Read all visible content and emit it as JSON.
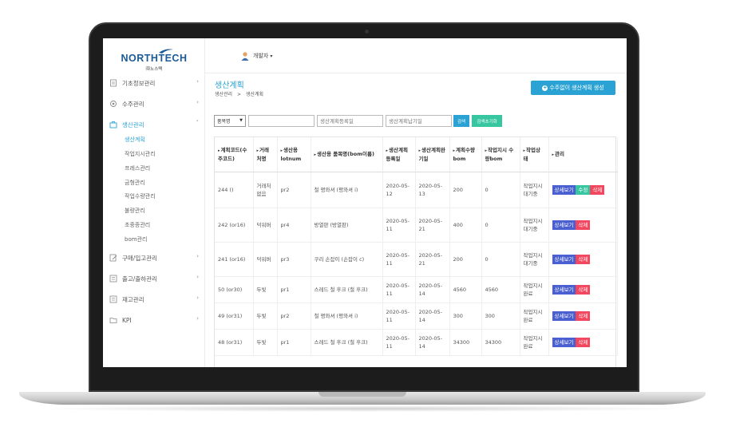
{
  "colors": {
    "accent": "#2aa3d4",
    "detail": "#4a5fd0",
    "edit": "#36c6a0",
    "delete": "#f2475f",
    "logo": "#1a5a96"
  },
  "logo": {
    "name": "NORTHTECH",
    "sub": "㈜노스텍"
  },
  "user": {
    "name": "개발자",
    "icon": "user-avatar-icon"
  },
  "sidebar": {
    "items": [
      {
        "label": "기초정보관리",
        "icon": "doc-icon"
      },
      {
        "label": "수주관리",
        "icon": "gear-icon"
      },
      {
        "label": "생산관리",
        "icon": "briefcase-icon"
      },
      {
        "label": "구매/입고관리",
        "icon": "edit-icon"
      },
      {
        "label": "출고/출하관리",
        "icon": "list-icon"
      },
      {
        "label": "재고관리",
        "icon": "list-icon"
      },
      {
        "label": "KPI",
        "icon": "folder-icon"
      }
    ],
    "submenu": [
      "생산계획",
      "작업지시관리",
      "프레스관리",
      "금형관리",
      "작업수량관리",
      "불량관리",
      "초중종관리",
      "bom관리"
    ]
  },
  "page": {
    "title": "생산계획",
    "breadcrumb_1": "생산관리",
    "breadcrumb_sep": ">",
    "breadcrumb_2": "생산계획",
    "create_label": "수주없이 생산계획 생성"
  },
  "filter": {
    "select_value": "품목명",
    "input_placeholder": "",
    "date1_placeholder": "생산계획등록일",
    "date2_placeholder": "생산계획납기일",
    "search_label": "검색",
    "reset_label": "검색초기화"
  },
  "table": {
    "headers": [
      "계획코드(수주코드)",
      "거래처명",
      "생산용 lotnum",
      "생산용 품목명(bom이름)",
      "생산계획등록일",
      "생산계획완기일",
      "계획수량bom",
      "작업지시 수량bom",
      "작업상태",
      "관리"
    ],
    "rows": [
      {
        "code": "244 ()",
        "client": "거래처없음",
        "lot": "pr2",
        "item": "철 평와셔 (평와셔 i)",
        "reg": "2020-05-12",
        "due": "2020-05-13",
        "qty": "200",
        "order_qty": "0",
        "status": "작업지시대기중",
        "actions": [
          "상세보기",
          "수정",
          "삭제"
        ]
      },
      {
        "code": "242 (or16)",
        "client": "덕워버",
        "lot": "pr4",
        "item": "방열판 (방열판)",
        "reg": "2020-05-11",
        "due": "2020-05-21",
        "qty": "400",
        "order_qty": "0",
        "status": "작업지시대기중",
        "actions": [
          "상세보기",
          "삭제"
        ]
      },
      {
        "code": "241 (or16)",
        "client": "덕워버",
        "lot": "pr3",
        "item": "쿠리 손잡이 (손잡이 c)",
        "reg": "2020-05-11",
        "due": "2020-05-21",
        "qty": "200",
        "order_qty": "0",
        "status": "작업지시대기중",
        "actions": [
          "상세보기",
          "삭제"
        ]
      },
      {
        "code": "50 (or30)",
        "client": "두빛",
        "lot": "pr1",
        "item": "스레드 철 후크 (철 후크)",
        "reg": "2020-05-11",
        "due": "2020-05-14",
        "qty": "4560",
        "order_qty": "4560",
        "status": "작업지시완료",
        "actions": [
          "상세보기",
          "삭제"
        ]
      },
      {
        "code": "49 (or31)",
        "client": "두빛",
        "lot": "pr2",
        "item": "철 평와셔 (평와셔 i)",
        "reg": "2020-05-11",
        "due": "2020-05-14",
        "qty": "300",
        "order_qty": "300",
        "status": "작업지시완료",
        "actions": [
          "상세보기",
          "삭제"
        ]
      },
      {
        "code": "48 (or31)",
        "client": "두빛",
        "lot": "pr1",
        "item": "스레드 철 후크 (철 후크)",
        "reg": "2020-05-11",
        "due": "2020-05-14",
        "qty": "34300",
        "order_qty": "34300",
        "status": "작업지시완료",
        "actions": [
          "상세보기",
          "삭제"
        ]
      }
    ]
  }
}
